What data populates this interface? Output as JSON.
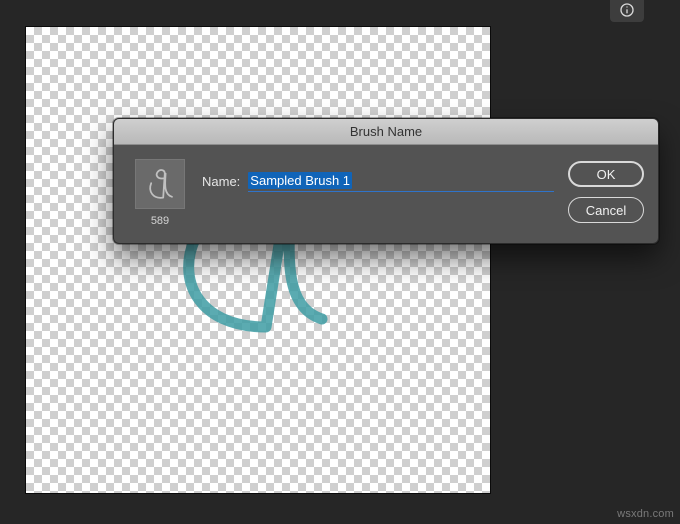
{
  "toolbar": {
    "info_icon": "info-icon"
  },
  "canvas": {
    "stroke_color": "#3e9ca3"
  },
  "dialog": {
    "title": "Brush Name",
    "thumb_size": "589",
    "name_label": "Name:",
    "name_value": "Sampled Brush 1",
    "buttons": {
      "ok": "OK",
      "cancel": "Cancel"
    }
  },
  "watermark": "wsxdn.com"
}
